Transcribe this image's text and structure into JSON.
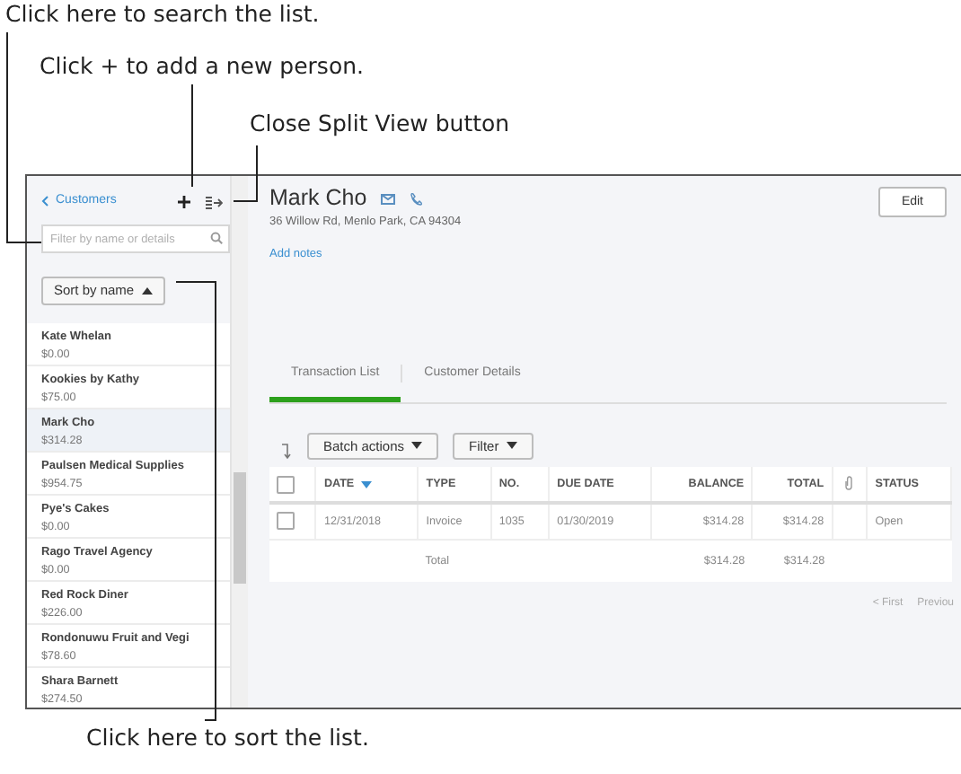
{
  "callouts_top": [
    {
      "text": "Click here to search the list."
    },
    {
      "text": "Click + to add a new person."
    },
    {
      "text": "Close Split View button"
    }
  ],
  "sidebar": {
    "back_link": "Customers",
    "filter": {
      "placeholder": "Filter by name or details"
    },
    "sort_button": "Sort by name",
    "customers": [
      {
        "name": "Kate Whelan",
        "balance": "$0.00",
        "selected": false
      },
      {
        "name": "Kookies by Kathy",
        "balance": "$75.00",
        "selected": false
      },
      {
        "name": "Mark Cho",
        "balance": "$314.28",
        "selected": true
      },
      {
        "name": "Paulsen Medical Supplies",
        "balance": "$954.75",
        "selected": false
      },
      {
        "name": "Pye's Cakes",
        "balance": "$0.00",
        "selected": false
      },
      {
        "name": "Rago Travel Agency",
        "balance": "$0.00",
        "selected": false
      },
      {
        "name": "Red Rock Diner",
        "balance": "$226.00",
        "selected": false
      },
      {
        "name": "Rondonuwu Fruit and Vegi",
        "balance": "$78.60",
        "selected": false
      },
      {
        "name": "Shara Barnett",
        "balance": "$274.50",
        "selected": false
      }
    ]
  },
  "detail": {
    "name": "Mark Cho",
    "address": "36 Willow Rd, Menlo Park, CA 94304",
    "add_notes": "Add notes",
    "edit_button": "Edit",
    "tabs": [
      {
        "label": "Transaction List",
        "selected": true
      },
      {
        "label": "Customer Details",
        "selected": false
      }
    ],
    "batch_actions": "Batch actions",
    "filter_button": "Filter",
    "select_all_checked": false,
    "columns": [
      {
        "kind": "text",
        "label": "DATE",
        "sorted": true
      },
      {
        "kind": "text",
        "label": "TYPE",
        "sorted": false
      },
      {
        "kind": "text",
        "label": "NO.",
        "sorted": false
      },
      {
        "kind": "text",
        "label": "DUE DATE",
        "sorted": false
      },
      {
        "kind": "amount",
        "label": "BALANCE",
        "sorted": false
      },
      {
        "kind": "amount",
        "label": "TOTAL",
        "sorted": false
      },
      {
        "kind": "attachment"
      },
      {
        "kind": "text",
        "label": "STATUS",
        "sorted": false
      }
    ],
    "rows": [
      {
        "checked": false,
        "cells": [
          "12/31/2018",
          "Invoice",
          "1035",
          "01/30/2019",
          "$314.28",
          "$314.28",
          "",
          "Open"
        ]
      }
    ],
    "total_row": {
      "label": "Total",
      "balance": "$314.28",
      "total": "$314.28"
    },
    "pagination": [
      "< First",
      "Previou"
    ]
  },
  "callout_bottom": {
    "text": "Click here to sort the list."
  }
}
